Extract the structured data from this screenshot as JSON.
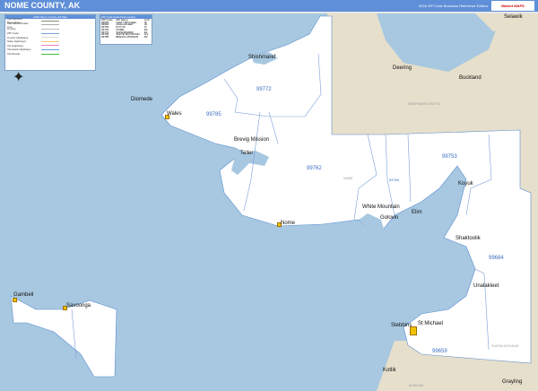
{
  "header": {
    "title": "NOME COUNTY, AK",
    "edition": "2026 ZIP Code Business Reference Edition",
    "logo": "Market MAPS"
  },
  "legend": {
    "title": "2026 Nome County, AK Map",
    "items": [
      "International Boundaries",
      "International Date Line",
      "County",
      "ZIP Code",
      "County Highways",
      "State Highways",
      "US Highways",
      "Interstate Highways",
      "Toll Roads"
    ]
  },
  "zip_table": {
    "title": "ZIP Code Index/Grid Locator",
    "headers": [
      "ZIP Code",
      "ZIP Name",
      "LOC"
    ],
    "rows": [
      [
        "99659",
        "SAINT MICHAEL",
        "I8"
      ],
      [
        "99684",
        "UNALAKLEET",
        "J6"
      ],
      [
        "99753",
        "KOYUK",
        "I3"
      ],
      [
        "99762",
        "NOME",
        "E4"
      ],
      [
        "99772",
        "SHISHMAREF",
        "E1"
      ],
      [
        "99784",
        "WHITE MOUNTAIN",
        "G4"
      ],
      [
        "99785",
        "BREVIG MISSION",
        "D2"
      ]
    ]
  },
  "colors": {
    "water": "#a7c8e0",
    "county": "#ffffff",
    "other_land": "#e6dfcb",
    "zip_boundary": "#7a9fd6",
    "title_bar": "#5f8fd8"
  },
  "cities": [
    {
      "name": "Selawik"
    },
    {
      "name": "Shishmaref"
    },
    {
      "name": "Deering"
    },
    {
      "name": "Buckland"
    },
    {
      "name": "Diomede"
    },
    {
      "name": "Wales"
    },
    {
      "name": "Brevig Mission"
    },
    {
      "name": "Teller"
    },
    {
      "name": "Nome"
    },
    {
      "name": "White Mountain"
    },
    {
      "name": "Golovin"
    },
    {
      "name": "Elim"
    },
    {
      "name": "Koyuk"
    },
    {
      "name": "Shaktoolik"
    },
    {
      "name": "Unalakleet"
    },
    {
      "name": "Stebbins"
    },
    {
      "name": "St Michael"
    },
    {
      "name": "Gambell"
    },
    {
      "name": "Savoonga"
    },
    {
      "name": "Kotlik"
    },
    {
      "name": "Grayling"
    }
  ],
  "zips": [
    "99772",
    "99785",
    "99762",
    "99753",
    "99784",
    "99684",
    "99659"
  ],
  "regions": [
    "NOME",
    "NORTHWEST ARCTIC",
    "YUKON-KOYUKUK",
    "KUSILVAK"
  ]
}
